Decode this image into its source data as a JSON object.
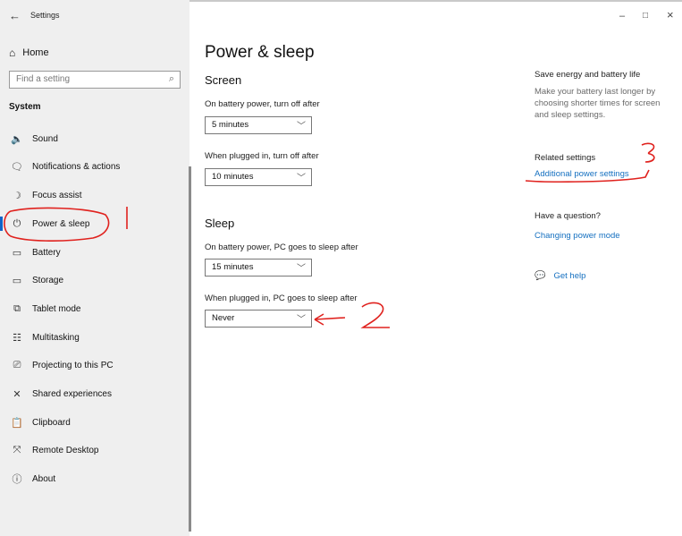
{
  "window": {
    "title": "Settings",
    "back_glyph": "←",
    "minimize": "–",
    "maximize": "□",
    "close": "×"
  },
  "sidebar": {
    "home": "Home",
    "search_placeholder": "Find a setting",
    "section": "System",
    "items": [
      {
        "label": "Sound",
        "icon": "speaker-icon"
      },
      {
        "label": "Notifications & actions",
        "icon": "notifications-icon"
      },
      {
        "label": "Focus assist",
        "icon": "moon-icon"
      },
      {
        "label": "Power & sleep",
        "icon": "power-icon",
        "selected": true
      },
      {
        "label": "Battery",
        "icon": "battery-icon"
      },
      {
        "label": "Storage",
        "icon": "storage-icon"
      },
      {
        "label": "Tablet mode",
        "icon": "tablet-icon"
      },
      {
        "label": "Multitasking",
        "icon": "multitasking-icon"
      },
      {
        "label": "Projecting to this PC",
        "icon": "projector-icon"
      },
      {
        "label": "Shared experiences",
        "icon": "shared-icon"
      },
      {
        "label": "Clipboard",
        "icon": "clipboard-icon"
      },
      {
        "label": "Remote Desktop",
        "icon": "remote-desktop-icon"
      },
      {
        "label": "About",
        "icon": "info-icon"
      }
    ]
  },
  "main": {
    "title": "Power & sleep",
    "screen": {
      "heading": "Screen",
      "battery_label": "On battery power, turn off after",
      "battery_value": "5 minutes",
      "plugged_label": "When plugged in, turn off after",
      "plugged_value": "10 minutes"
    },
    "sleep": {
      "heading": "Sleep",
      "battery_label": "On battery power, PC goes to sleep after",
      "battery_value": "15 minutes",
      "plugged_label": "When plugged in, PC goes to sleep after",
      "plugged_value": "Never"
    }
  },
  "right": {
    "save_title": "Save energy and battery life",
    "save_text": "Make your battery last longer by choosing shorter times for screen and sleep settings.",
    "related_title": "Related settings",
    "related_link": "Additional power settings",
    "question_title": "Have a question?",
    "question_link": "Changing power mode",
    "help_link": "Get help"
  },
  "annotations": {
    "one": "1",
    "two": "2",
    "three": "3",
    "color": "#e0221e"
  }
}
